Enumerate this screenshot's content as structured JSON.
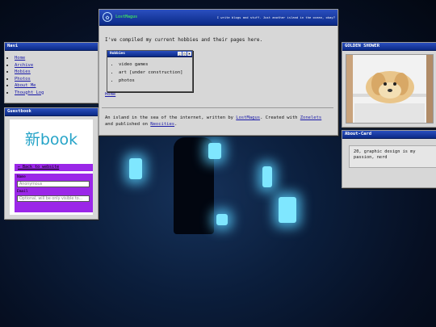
{
  "navi": {
    "title": "Navi",
    "items": [
      "Home",
      "Archive",
      "Hobies",
      "Photos",
      "About Me",
      "Thought Log"
    ]
  },
  "guestbook": {
    "title": "Guestbook",
    "logo_text": "新book",
    "back_link": "← Back to website",
    "name_label": "Name",
    "name_placeholder": "Anonymous",
    "email_label": "Email",
    "email_placeholder": "Optional, will be only visible to..."
  },
  "main": {
    "site_name": "LostMagus",
    "tagline": "I write blogs and stuff. Just another island in the ocean, okay?",
    "intro": "I've compiled my current hobbies and their pages here.",
    "hobbies_title": "Hobbies",
    "hobbies": [
      "video games",
      "art [under construction]",
      "photos"
    ],
    "home_link": "Home",
    "footer_pre": "An island in the sea of the internet, written by ",
    "footer_author": "LostMagus",
    "footer_mid": ". Created with ",
    "footer_tool": "Zonelets",
    "footer_and": " and published on ",
    "footer_host": "Neocities",
    "footer_end": "."
  },
  "golden": {
    "title": "GOLDEN SHOWER"
  },
  "about": {
    "title": "About-Card",
    "text": "20, graphic design is my passion, nerd"
  },
  "colors": {
    "titlebar": "#0b2a86",
    "window": "#d7d7d7",
    "guestbook_accent": "#9b27e8",
    "logo_blue": "#26a4c8"
  }
}
